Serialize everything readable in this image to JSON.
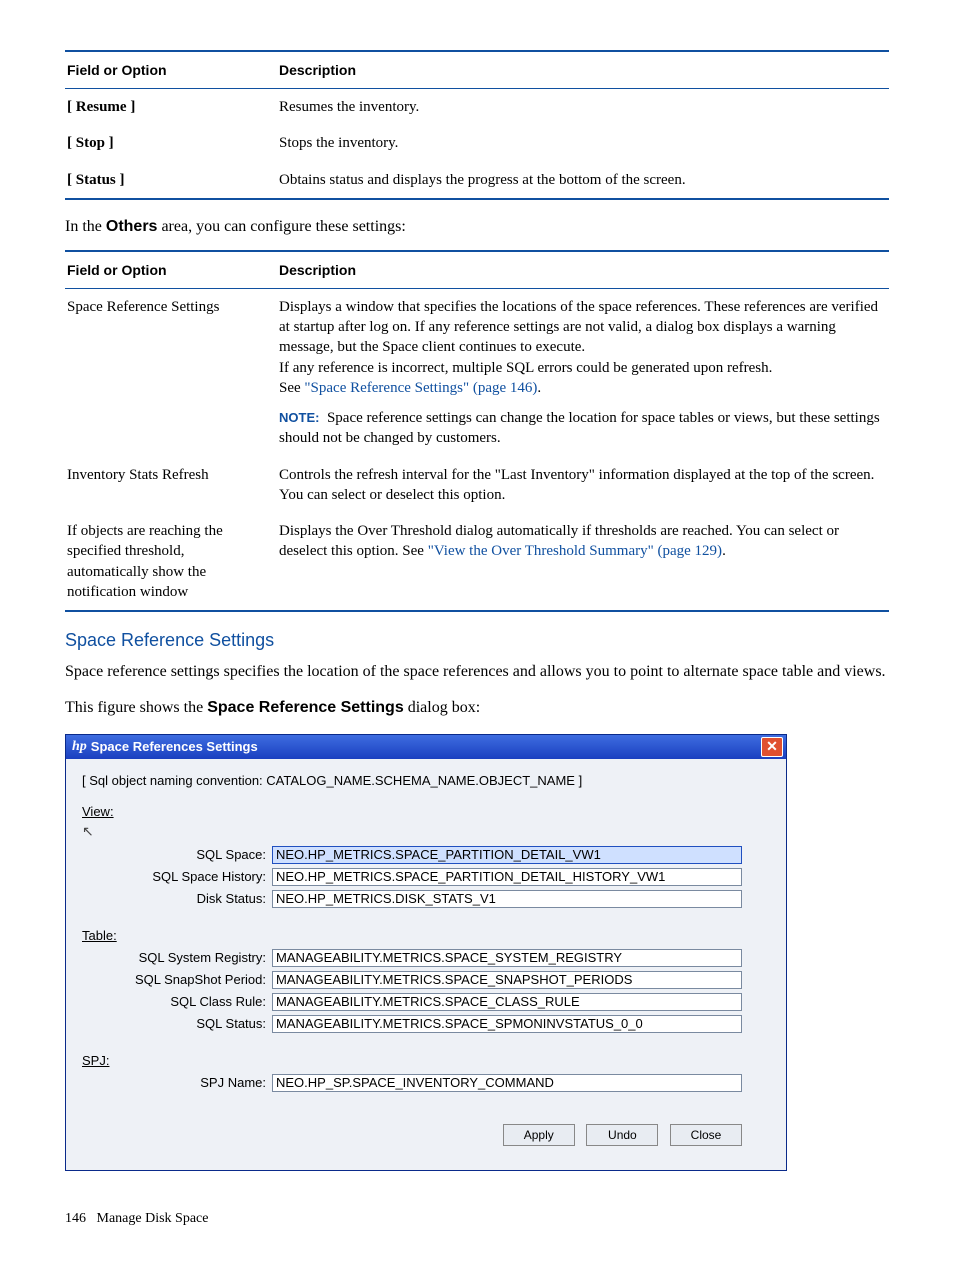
{
  "table1": {
    "hdr_field": "Field or Option",
    "hdr_desc": "Description",
    "rows": [
      {
        "f": "[ Resume ]",
        "d": "Resumes the inventory."
      },
      {
        "f": "[ Stop ]",
        "d": "Stops the inventory."
      },
      {
        "f": "[ Status ]",
        "d": "Obtains status and displays the progress at the bottom of the screen."
      }
    ]
  },
  "others_prefix": "In the ",
  "others_bold": "Others",
  "others_suffix": " area, you can configure these settings:",
  "table2": {
    "hdr_field": "Field or Option",
    "hdr_desc": "Description",
    "r0_f": "Space Reference Settings",
    "r0_d_a": "Displays a window that specifies the locations of the space references. These references are verified at startup after log on. If any reference settings are not valid, a dialog box displays a warning message, but the Space client continues to execute.",
    "r0_d_b": "If any reference is incorrect, multiple SQL errors could be generated upon refresh.",
    "r0_d_c_pre": "See ",
    "r0_d_c_link": "\"Space Reference Settings\" (page 146)",
    "r0_d_c_post": ".",
    "note_label": "NOTE:",
    "r0_note": "Space reference settings can change the location for space tables or views, but these settings should not be changed by customers.",
    "r1_f": "Inventory Stats Refresh",
    "r1_d": "Controls the refresh interval for the \"Last Inventory\" information displayed at the top of the screen. You can select or deselect this option.",
    "r2_f": "If objects are reaching the specified threshold, automatically show the notification window",
    "r2_d_pre": "Displays the Over Threshold dialog automatically if thresholds are reached. You can select or deselect this option. See ",
    "r2_d_link": "\"View the Over Threshold Summary\" (page 129)",
    "r2_d_post": "."
  },
  "subhead": "Space Reference Settings",
  "para1": "Space reference settings specifies the location of the space references and allows you to point to alternate space table and views.",
  "para2_pre": "This figure shows the ",
  "para2_bold": "Space Reference Settings",
  "para2_post": " dialog box:",
  "dialog": {
    "hp": "hp",
    "title": "Space References  Settings",
    "convention": "[ Sql object naming convention: CATALOG_NAME.SCHEMA_NAME.OBJECT_NAME ]",
    "sect_view": "View:",
    "sect_table": "Table:",
    "sect_spj": "SPJ:",
    "view": {
      "sql_space_lbl": "SQL Space:",
      "sql_space_val": "NEO.HP_METRICS.SPACE_PARTITION_DETAIL_VW1",
      "sql_hist_lbl": "SQL Space History:",
      "sql_hist_val": "NEO.HP_METRICS.SPACE_PARTITION_DETAIL_HISTORY_VW1",
      "disk_lbl": "Disk Status:",
      "disk_val": "NEO.HP_METRICS.DISK_STATS_V1"
    },
    "table": {
      "sysreg_lbl": "SQL System Registry:",
      "sysreg_val": "MANAGEABILITY.METRICS.SPACE_SYSTEM_REGISTRY",
      "snap_lbl": "SQL SnapShot Period:",
      "snap_val": "MANAGEABILITY.METRICS.SPACE_SNAPSHOT_PERIODS",
      "class_lbl": "SQL Class Rule:",
      "class_val": "MANAGEABILITY.METRICS.SPACE_CLASS_RULE",
      "status_lbl": "SQL Status:",
      "status_val": "MANAGEABILITY.METRICS.SPACE_SPMONINVSTATUS_0_0"
    },
    "spj": {
      "name_lbl": "SPJ Name:",
      "name_val": "NEO.HP_SP.SPACE_INVENTORY_COMMAND"
    },
    "btn_apply": "Apply",
    "btn_undo": "Undo",
    "btn_close": "Close"
  },
  "footer_page": "146",
  "footer_text": "Manage Disk Space"
}
